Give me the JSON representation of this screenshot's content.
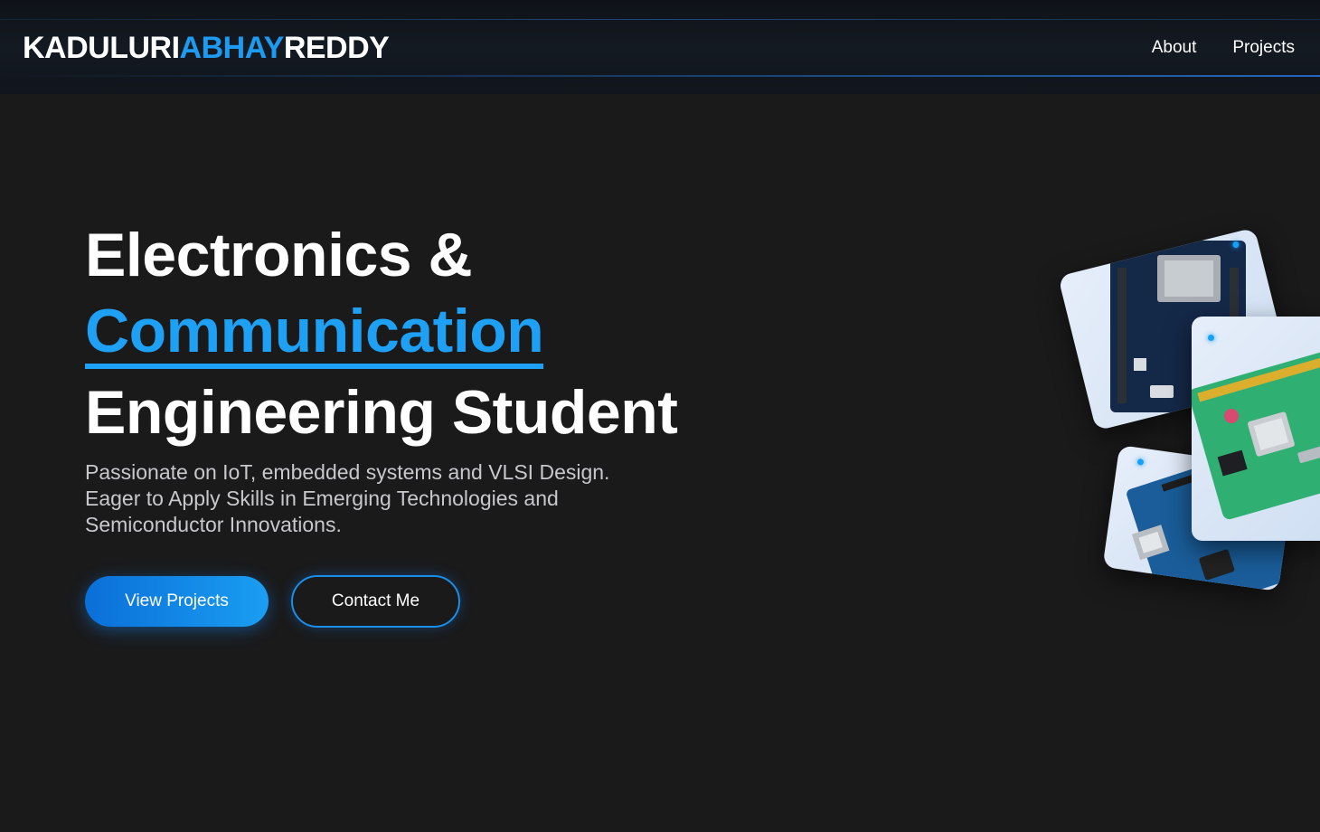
{
  "header": {
    "logo": {
      "part1": "KADULURI",
      "part2": "ABHAY",
      "part3": "REDDY"
    },
    "nav": [
      {
        "label": "About"
      },
      {
        "label": "Projects"
      }
    ]
  },
  "hero": {
    "title_line1": "Electronics &",
    "title_accent": "Communication",
    "title_line3": "Engineering Student",
    "description": "Passionate on IoT, embedded systems and VLSI Design. Eager to Apply Skills in Emerging Technologies and Semiconductor Innovations.",
    "primary_button": "View Projects",
    "secondary_button": "Contact Me"
  },
  "cards": [
    {
      "icon": "esp32-board-image"
    },
    {
      "icon": "arduino-board-image"
    },
    {
      "icon": "raspberry-pi-board-image"
    }
  ],
  "colors": {
    "accent": "#1ea0f5",
    "background": "#1a1a1b",
    "header_bg": "#121820"
  }
}
